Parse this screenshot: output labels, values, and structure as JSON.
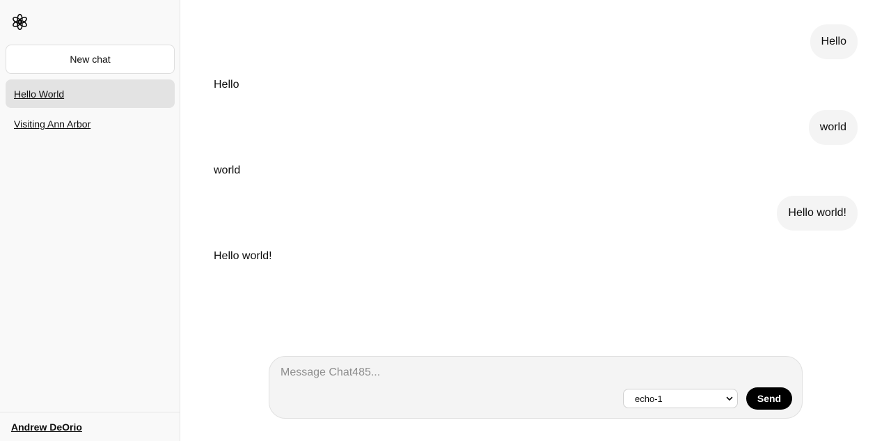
{
  "sidebar": {
    "logo_icon": "openai-logo-icon",
    "new_chat_label": "New chat",
    "chats": [
      {
        "label": "Hello World",
        "active": true
      },
      {
        "label": "Visiting Ann Arbor",
        "active": false
      }
    ],
    "user_name": "Andrew DeOrio"
  },
  "conversation": {
    "messages": [
      {
        "role": "user",
        "text": "Hello"
      },
      {
        "role": "assistant",
        "text": "Hello"
      },
      {
        "role": "user",
        "text": "world"
      },
      {
        "role": "assistant",
        "text": "world"
      },
      {
        "role": "user",
        "text": "Hello world!"
      },
      {
        "role": "assistant",
        "text": "Hello world!"
      }
    ]
  },
  "composer": {
    "placeholder": "Message Chat485...",
    "value": "",
    "model_selected": "echo-1",
    "send_label": "Send"
  },
  "colors": {
    "sidebar_bg": "#f9f9f9",
    "active_chat_bg": "#e3e3e3",
    "user_bubble_bg": "#f4f4f4",
    "send_button_bg": "#000000"
  }
}
